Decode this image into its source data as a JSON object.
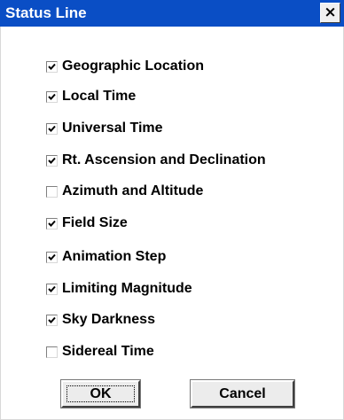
{
  "window": {
    "title": "Status Line",
    "close_glyph": "×"
  },
  "options": [
    {
      "label": "Geographic Location",
      "checked": true
    },
    {
      "label": "Local Time",
      "checked": true
    },
    {
      "label": "Universal Time",
      "checked": true
    },
    {
      "label": "Rt. Ascension and Declination",
      "checked": true
    },
    {
      "label": "Azimuth and Altitude",
      "checked": false
    },
    {
      "label": "Field Size",
      "checked": true
    },
    {
      "label": "Animation Step",
      "checked": true
    },
    {
      "label": "Limiting Magnitude",
      "checked": true
    },
    {
      "label": "Sky Darkness",
      "checked": true
    },
    {
      "label": "Sidereal Time",
      "checked": false
    }
  ],
  "buttons": {
    "ok": "OK",
    "cancel": "Cancel"
  },
  "colors": {
    "titlebar": "#0a4ec5",
    "background": "#ffffff",
    "button_face": "#ececec"
  }
}
